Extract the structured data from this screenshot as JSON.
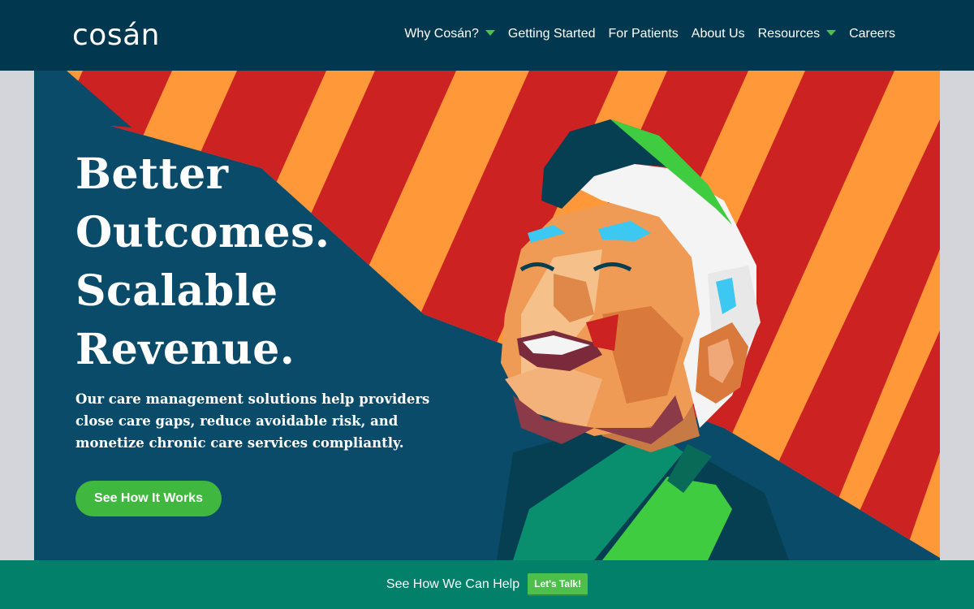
{
  "brand": {
    "logo_text": "cosán"
  },
  "nav": {
    "items": [
      {
        "label": "Why Cosán?",
        "has_dropdown": true
      },
      {
        "label": "Getting Started",
        "has_dropdown": false
      },
      {
        "label": "For Patients",
        "has_dropdown": false
      },
      {
        "label": "About Us",
        "has_dropdown": false
      },
      {
        "label": "Resources",
        "has_dropdown": true
      },
      {
        "label": "Careers",
        "has_dropdown": false
      }
    ]
  },
  "hero": {
    "headline_lines": [
      "Better",
      "Outcomes.",
      "Scalable",
      "Revenue."
    ],
    "subcopy": "Our care management solutions help providers close care gaps, reduce avoidable risk, and monetize chronic care services compliantly.",
    "cta_label": "See How It Works",
    "illustration": "smiling-elderly-man-illustration"
  },
  "footer_bar": {
    "text": "See How We Can Help",
    "button_label": "Let's Talk!"
  },
  "colors": {
    "navy": "#02384f",
    "hero_blue": "#0b4b6a",
    "orange": "#ff9838",
    "red": "#cc2222",
    "green": "#40b73f",
    "teal_bar": "#03806a"
  }
}
